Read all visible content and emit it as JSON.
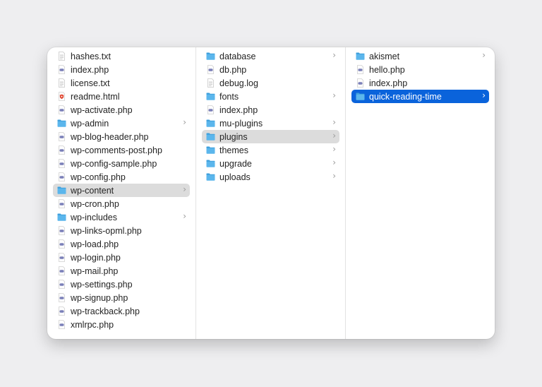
{
  "columns": [
    {
      "items": [
        {
          "label": "hashes.txt",
          "icon": "text-file-icon",
          "folder": false
        },
        {
          "label": "index.php",
          "icon": "php-file-icon",
          "folder": false
        },
        {
          "label": "license.txt",
          "icon": "text-file-icon",
          "folder": false
        },
        {
          "label": "readme.html",
          "icon": "html-file-icon",
          "folder": false
        },
        {
          "label": "wp-activate.php",
          "icon": "php-file-icon",
          "folder": false
        },
        {
          "label": "wp-admin",
          "icon": "folder-icon",
          "folder": true
        },
        {
          "label": "wp-blog-header.php",
          "icon": "php-file-icon",
          "folder": false
        },
        {
          "label": "wp-comments-post.php",
          "icon": "php-file-icon",
          "folder": false
        },
        {
          "label": "wp-config-sample.php",
          "icon": "php-file-icon",
          "folder": false
        },
        {
          "label": "wp-config.php",
          "icon": "php-file-icon",
          "folder": false
        },
        {
          "label": "wp-content",
          "icon": "folder-icon",
          "folder": true,
          "selected": "inactive"
        },
        {
          "label": "wp-cron.php",
          "icon": "php-file-icon",
          "folder": false
        },
        {
          "label": "wp-includes",
          "icon": "folder-icon",
          "folder": true
        },
        {
          "label": "wp-links-opml.php",
          "icon": "php-file-icon",
          "folder": false
        },
        {
          "label": "wp-load.php",
          "icon": "php-file-icon",
          "folder": false
        },
        {
          "label": "wp-login.php",
          "icon": "php-file-icon",
          "folder": false
        },
        {
          "label": "wp-mail.php",
          "icon": "php-file-icon",
          "folder": false
        },
        {
          "label": "wp-settings.php",
          "icon": "php-file-icon",
          "folder": false
        },
        {
          "label": "wp-signup.php",
          "icon": "php-file-icon",
          "folder": false
        },
        {
          "label": "wp-trackback.php",
          "icon": "php-file-icon",
          "folder": false
        },
        {
          "label": "xmlrpc.php",
          "icon": "php-file-icon",
          "folder": false
        }
      ]
    },
    {
      "items": [
        {
          "label": "database",
          "icon": "folder-icon",
          "folder": true
        },
        {
          "label": "db.php",
          "icon": "php-file-icon",
          "folder": false
        },
        {
          "label": "debug.log",
          "icon": "text-file-icon",
          "folder": false
        },
        {
          "label": "fonts",
          "icon": "folder-icon",
          "folder": true
        },
        {
          "label": "index.php",
          "icon": "php-file-icon",
          "folder": false
        },
        {
          "label": "mu-plugins",
          "icon": "folder-icon",
          "folder": true
        },
        {
          "label": "plugins",
          "icon": "folder-icon",
          "folder": true,
          "selected": "inactive"
        },
        {
          "label": "themes",
          "icon": "folder-icon",
          "folder": true
        },
        {
          "label": "upgrade",
          "icon": "folder-icon",
          "folder": true
        },
        {
          "label": "uploads",
          "icon": "folder-icon",
          "folder": true
        }
      ]
    },
    {
      "items": [
        {
          "label": "akismet",
          "icon": "folder-icon",
          "folder": true
        },
        {
          "label": "hello.php",
          "icon": "php-file-icon",
          "folder": false
        },
        {
          "label": "index.php",
          "icon": "php-file-icon",
          "folder": false
        },
        {
          "label": "quick-reading-time",
          "icon": "folder-icon",
          "folder": true,
          "selected": "active"
        }
      ]
    }
  ],
  "chevron_glyph": "›",
  "colors": {
    "folder": "#5bb6ec",
    "folder_tab": "#3d9fdc",
    "selection_active": "#0a63db",
    "selection_inactive": "#dcdcdc",
    "php_badge": "#7a7fb8",
    "html_badge": "#e0452f"
  }
}
